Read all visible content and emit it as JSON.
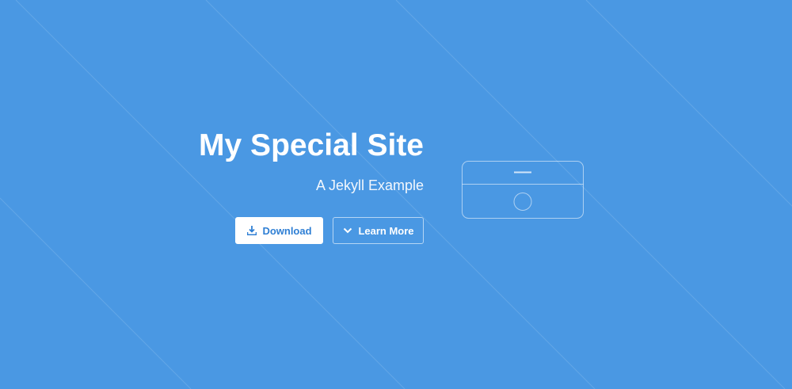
{
  "hero": {
    "title": "My Special Site",
    "subtitle": "A Jekyll Example"
  },
  "buttons": {
    "download_label": "Download",
    "learn_more_label": "Learn More"
  },
  "icons": {
    "download": "download-icon",
    "learn_more": "chevron-down-icon",
    "device": "device-outline-icon"
  },
  "colors": {
    "background": "#4a98e3",
    "download_text": "#2f7fd4",
    "text": "#ffffff"
  }
}
